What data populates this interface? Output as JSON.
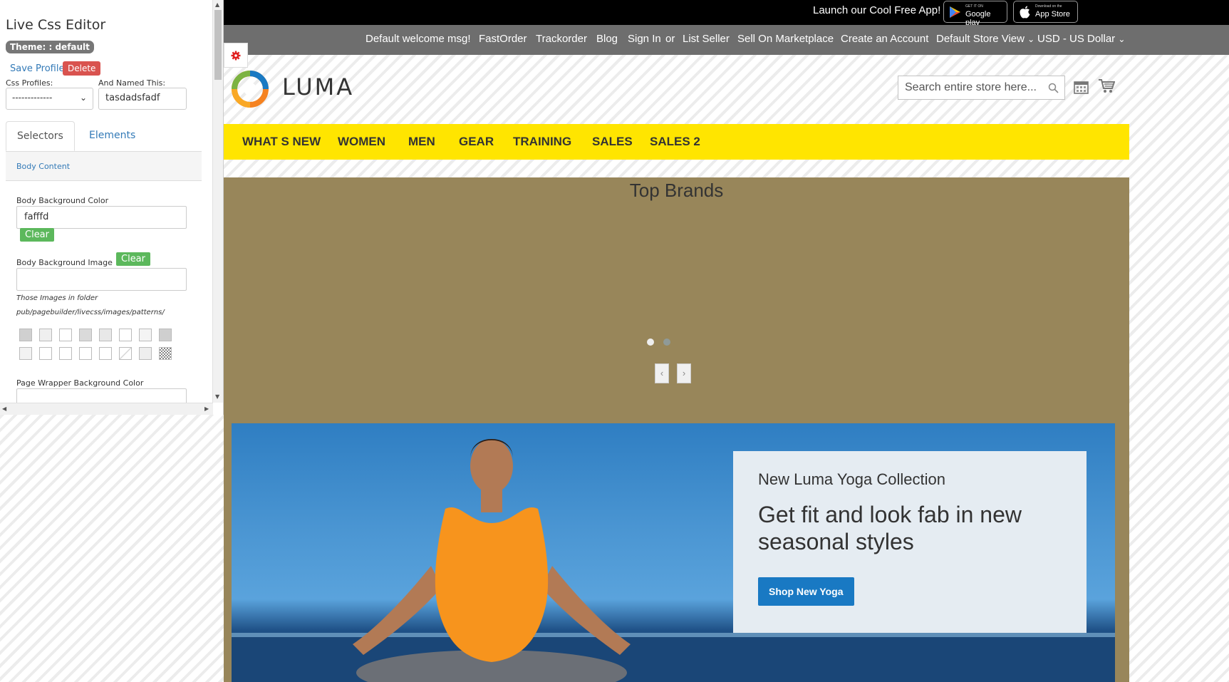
{
  "editor": {
    "title": "Live Css Editor",
    "theme_badge": "Theme: : default",
    "save_profile": "Save Profile",
    "delete": "Delete",
    "css_profiles_label": "Css Profiles:",
    "named_label": "And Named This:",
    "profile_value": "-------------",
    "name_value": "tasdadsfadf",
    "tabs": [
      "Selectors",
      "Elements"
    ],
    "section_title": "Body Content",
    "body_bg_color_label": "Body Background Color",
    "body_bg_color_value": "fafffd",
    "clear_label": "Clear",
    "body_bg_image_label": "Body Background Image",
    "hint_line1": "Those Images in folder",
    "hint_line2": "pub/pagebuilder/livecss/images/patterns/",
    "page_wrapper_label": "Page Wrapper Background Color"
  },
  "promo": {
    "text": "Launch our Cool Free App!",
    "google_small": "GET IT ON",
    "google_big": "Google play",
    "apple_small": "Download on the",
    "apple_big": "App Store"
  },
  "header_links": {
    "welcome": "Default welcome msg!",
    "fastorder": "FastOrder",
    "trackorder": "Trackorder",
    "blog": "Blog",
    "signin": "Sign In",
    "or": "or",
    "list_seller": "List Seller",
    "sell": "Sell On Marketplace",
    "create": "Create an Account",
    "store_view": "Default Store View",
    "currency": "USD - US Dollar"
  },
  "logo": {
    "text": "LUMA"
  },
  "search": {
    "placeholder": "Search entire store here..."
  },
  "nav": {
    "items": [
      "WHAT S NEW",
      "WOMEN",
      "MEN",
      "GEAR",
      "TRAINING",
      "SALES",
      "SALES 2"
    ]
  },
  "brands": {
    "heading": "Top Brands",
    "prev": "‹",
    "next": "›"
  },
  "hero": {
    "subtitle": "New Luma Yoga Collection",
    "headline": "Get fit and look fab in new seasonal styles",
    "button": "Shop New Yoga"
  },
  "colors": {
    "nav_bg": "#ffe500",
    "brands_bg": "#98865a",
    "accent": "#1979c3",
    "delete": "#d9534f",
    "clear": "#5cb85c"
  }
}
